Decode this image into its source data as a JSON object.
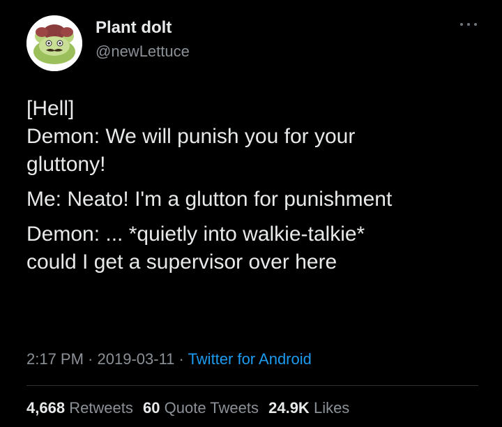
{
  "author": {
    "display_name": "Plant dolt",
    "handle": "@newLettuce",
    "avatar_icon": "lettuce-avatar-icon"
  },
  "tweet": {
    "lines": [
      "[Hell]",
      "Demon: We will punish you for your",
      "gluttony!",
      "Me: Neato! I'm a glutton for punishment",
      "Demon: ... *quietly into walkie-talkie*",
      "could I get a supervisor over here"
    ],
    "time": "2:17 PM",
    "date": "2019-03-11",
    "separator": " · ",
    "source": "Twitter for Android"
  },
  "stats": {
    "retweets_count": "4,668",
    "retweets_label": "Retweets",
    "quotes_count": "60",
    "quotes_label": "Quote Tweets",
    "likes_count": "24.9K",
    "likes_label": "Likes"
  },
  "colors": {
    "background": "#000000",
    "text": "#e7e9ea",
    "secondary": "#8b9197",
    "link": "#1d9bf0",
    "divider": "#2f3336"
  }
}
